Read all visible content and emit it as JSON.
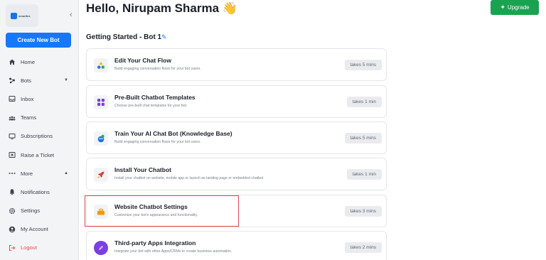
{
  "sidebar": {
    "logo_text": "smartbiz",
    "create_button": "Create New Bot",
    "items": [
      {
        "label": "Home",
        "icon": "home-icon"
      },
      {
        "label": "Bots",
        "icon": "bots-icon"
      },
      {
        "label": "Inbox",
        "icon": "inbox-icon"
      },
      {
        "label": "Teams",
        "icon": "teams-icon"
      },
      {
        "label": "Subscriptions",
        "icon": "subscriptions-icon"
      },
      {
        "label": "Raise a Ticket",
        "icon": "ticket-icon"
      },
      {
        "label": "More",
        "icon": "more-icon"
      },
      {
        "label": "Notifications",
        "icon": "bell-icon"
      },
      {
        "label": "Settings",
        "icon": "gear-icon"
      },
      {
        "label": "My Account",
        "icon": "account-icon"
      },
      {
        "label": "Logout",
        "icon": "logout-icon"
      }
    ]
  },
  "header": {
    "greeting": "Hello, Nirupam Sharma 👋",
    "upgrade": "Upgrade"
  },
  "section": {
    "title": "Getting Started - Bot 1"
  },
  "cards": [
    {
      "title": "Edit Your Chat Flow",
      "desc": "Build engaging conversation flows for your bot users.",
      "time": "takes 5 mins",
      "icon": "chat-flow-icon"
    },
    {
      "title": "Pre-Built Chatbot Templates",
      "desc": "Choose pre-built chat templates for your bot.",
      "time": "takes 1 min",
      "icon": "templates-icon"
    },
    {
      "title": "Train Your AI Chat Bot (Knowledge Base)",
      "desc": "Build engaging conversation flows for your bot users.",
      "time": "takes 5 mins",
      "icon": "knowledge-base-icon"
    },
    {
      "title": "Install Your Chatbot",
      "desc": "Install your chatbot on website, mobile app or launch as landing page or embedded chatbot",
      "time": "takes 1 min",
      "icon": "rocket-icon"
    },
    {
      "title": "Website Chatbot Settings",
      "desc": "Customize your bot's appearance and functionality.",
      "time": "takes 3 mins",
      "icon": "chatbot-settings-icon"
    },
    {
      "title": "Third-party Apps Integration",
      "desc": "Integrate your bot with other Apps/CRMs to create business automation.",
      "time": "takes 2 mins",
      "icon": "integration-icon"
    }
  ],
  "colors": {
    "primary": "#1677ff",
    "upgrade": "#1aa251",
    "highlight": "#e0474c",
    "logout": "#e5484d"
  }
}
